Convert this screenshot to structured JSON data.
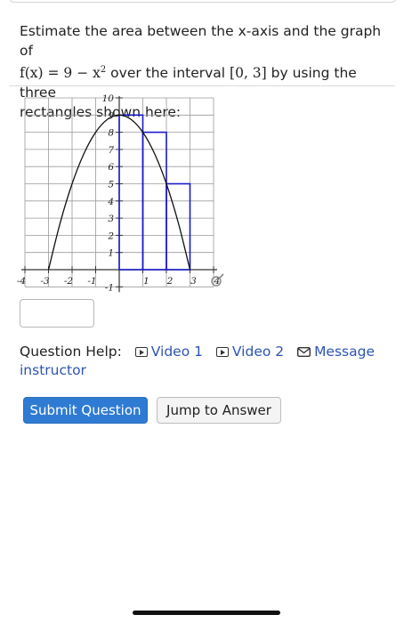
{
  "question": {
    "line1_prefix": "Estimate the area between the x-axis and the graph of",
    "line2_func": "f(x) = 9 − x",
    "line2_exp": "2",
    "line2_mid": " over the interval ",
    "line2_interval": "[0, 3]",
    "line2_suffix": " by using the three",
    "line3": "rectangles shown here:"
  },
  "chart_data": {
    "type": "line",
    "function": "f(x) = 9 - x^2",
    "xlim": [
      -4,
      4
    ],
    "ylim": [
      -1,
      10
    ],
    "grid": true,
    "x_tick_labels": [
      "-4",
      "-3",
      "-2",
      "-1",
      "1",
      "2",
      "3",
      "4"
    ],
    "x_tick_values": [
      -4,
      -3,
      -2,
      -1,
      1,
      2,
      3,
      4
    ],
    "y_tick_labels": [
      "-1",
      "1",
      "2",
      "3",
      "4",
      "5",
      "6",
      "7",
      "8",
      "9",
      "10"
    ],
    "y_tick_values": [
      -1,
      1,
      2,
      3,
      4,
      5,
      6,
      7,
      8,
      9,
      10
    ],
    "curve": {
      "x": [
        -3,
        -2.5,
        -2,
        -1.5,
        -1,
        -0.5,
        0,
        0.5,
        1,
        1.5,
        2,
        2.5,
        3
      ],
      "y": [
        0,
        2.75,
        5,
        6.75,
        8,
        8.75,
        9,
        8.75,
        8,
        6.75,
        5,
        2.75,
        0
      ]
    },
    "rectangles": [
      {
        "x0": 0,
        "x1": 1,
        "height": 9
      },
      {
        "x0": 1,
        "x1": 2,
        "height": 8
      },
      {
        "x0": 2,
        "x1": 3,
        "height": 5
      }
    ],
    "colors": {
      "curve": "#111111",
      "rectangles": "#1a1acc",
      "grid": "#9a9a9a"
    }
  },
  "answer": {
    "value": ""
  },
  "help": {
    "label": "Question Help:",
    "video1": "Video 1",
    "video2": "Video 2",
    "message": "Message",
    "message_cont": "instructor",
    "link_color": "#2d54b3"
  },
  "buttons": {
    "submit": "Submit Question",
    "jump": "Jump to Answer",
    "submit_color": "#2f7bd3"
  }
}
